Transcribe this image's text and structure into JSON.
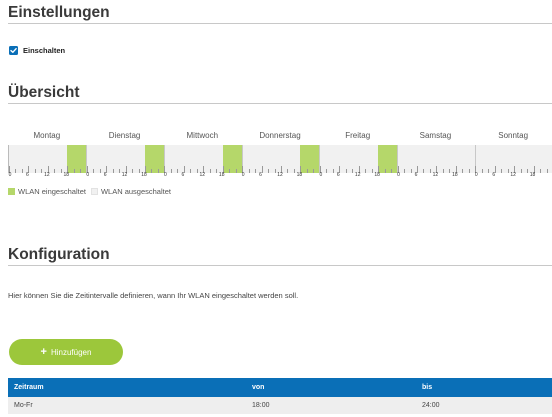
{
  "sections": {
    "einstellungen": "Einstellungen",
    "uebersicht": "Übersicht",
    "konfiguration": "Konfiguration"
  },
  "settings": {
    "enable_label": "Einschalten",
    "enabled": true
  },
  "overview": {
    "days": [
      "Montag",
      "Dienstag",
      "Mittwoch",
      "Donnerstag",
      "Freitag",
      "Samstag",
      "Sonntag"
    ],
    "hour_labels": [
      "0",
      "6",
      "12",
      "18"
    ],
    "wlan_on_intervals": [
      {
        "day": "Montag",
        "from": "18:00",
        "to": "24:00"
      },
      {
        "day": "Dienstag",
        "from": "18:00",
        "to": "24:00"
      },
      {
        "day": "Mittwoch",
        "from": "18:00",
        "to": "24:00"
      },
      {
        "day": "Donnerstag",
        "from": "18:00",
        "to": "24:00"
      },
      {
        "day": "Freitag",
        "from": "18:00",
        "to": "24:00"
      }
    ],
    "legend": {
      "on_label": "WLAN eingeschaltet",
      "off_label": "WLAN ausgeschaltet",
      "on_color": "#b5d76a",
      "off_color": "#f1f1f1"
    }
  },
  "config": {
    "description": "Hier können Sie die Zeitintervalle definieren, wann Ihr WLAN eingeschaltet werden soll.",
    "add_button_label": "Hinzufügen",
    "add_icon": "plus-icon",
    "table": {
      "headers": [
        "Zeitraum",
        "von",
        "bis"
      ],
      "rows": [
        [
          "Mo-Fr",
          "18:00",
          "24:00"
        ]
      ]
    }
  },
  "colors": {
    "accent_blue": "#0a6fb7",
    "accent_green": "#9cc73b"
  }
}
